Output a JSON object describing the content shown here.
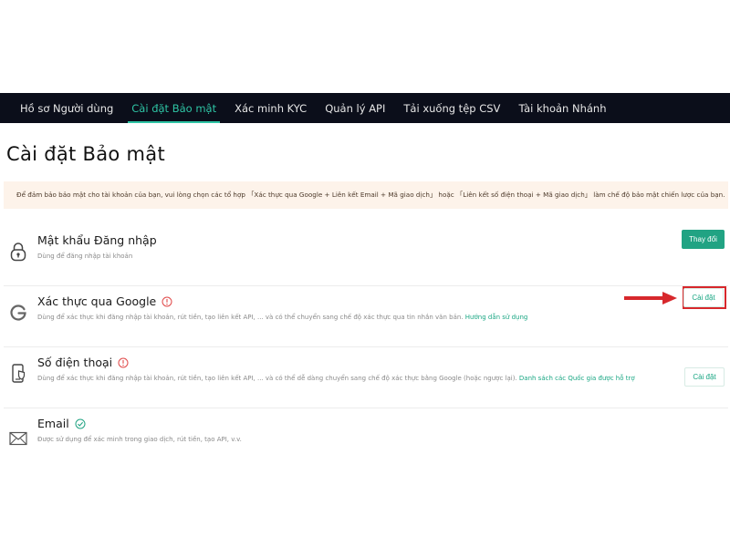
{
  "nav": {
    "tabs": [
      {
        "label": "Hồ sơ Người dùng"
      },
      {
        "label": "Cài đặt Bảo mật"
      },
      {
        "label": "Xác minh KYC"
      },
      {
        "label": "Quản lý API"
      },
      {
        "label": "Tải xuống tệp CSV"
      },
      {
        "label": "Tài khoản Nhánh"
      }
    ],
    "active_index": 1
  },
  "page": {
    "title": "Cài đặt Bảo mật",
    "notice": "Để đảm bảo bảo mật cho tài khoản của bạn, vui lòng chọn các tổ hợp 「Xác thực qua Google + Liên kết Email + Mã giao dịch」 hoặc 「Liên kết số điện thoại + Mã giao dịch」 làm chế độ bảo mật chiến lược của bạn."
  },
  "rows": {
    "password": {
      "icon": "lock-icon",
      "title": "Mật khẩu Đăng nhập",
      "desc": "Dùng để đăng nhập tài khoản",
      "button": "Thay đổi"
    },
    "google": {
      "icon": "google-icon",
      "status_icon": "warning-icon",
      "title": "Xác thực qua Google",
      "desc": "Dùng để xác thực khi đăng nhập tài khoản, rút tiền, tạo liên kết API, ... và có thể chuyển sang chế độ xác thực qua tin nhắn văn bản.",
      "link": "Hướng dẫn sử dụng",
      "button": "Cài đặt",
      "annotation_color": "#d7282c"
    },
    "phone": {
      "icon": "phone-icon",
      "status_icon": "warning-icon",
      "title": "Số điện thoại",
      "desc": "Dùng để xác thực khi đăng nhập tài khoản, rút tiền, tạo liên kết API, ... và có thể dễ dàng chuyển sang chế độ xác thực bằng Google (hoặc ngược lại).",
      "link": "Danh sách các Quốc gia được hỗ trợ",
      "button": "Cài đặt"
    },
    "email": {
      "icon": "envelope-icon",
      "status_icon": "check-circle-icon",
      "title": "Email",
      "desc": "Được sử dụng để xác minh trong giao dịch, rút tiền, tạo API, v.v."
    }
  },
  "colors": {
    "nav_bg": "#0b0e1a",
    "accent": "#21a383",
    "warning": "#e04848",
    "notice_bg": "#fdf3ea"
  }
}
